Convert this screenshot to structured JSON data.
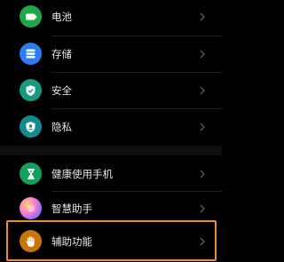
{
  "settings": {
    "items": [
      {
        "label": "电池",
        "icon": "battery-icon",
        "color": "#1fa84a"
      },
      {
        "label": "存储",
        "icon": "storage-icon",
        "color": "#2d7cf0"
      },
      {
        "label": "安全",
        "icon": "security-shield-icon",
        "color": "#159b80"
      },
      {
        "label": "隐私",
        "icon": "privacy-icon",
        "color": "#168b8f"
      },
      {
        "label": "健康使用手机",
        "icon": "hourglass-icon",
        "color": "#13a05a"
      },
      {
        "label": "智慧助手",
        "icon": "smart-assistant-icon",
        "color": "#d46cf0"
      },
      {
        "label": "辅助功能",
        "icon": "accessibility-hand-icon",
        "color": "#c9750e"
      }
    ]
  },
  "highlight": {
    "color": "#ea8a3a",
    "target": "辅助功能"
  }
}
